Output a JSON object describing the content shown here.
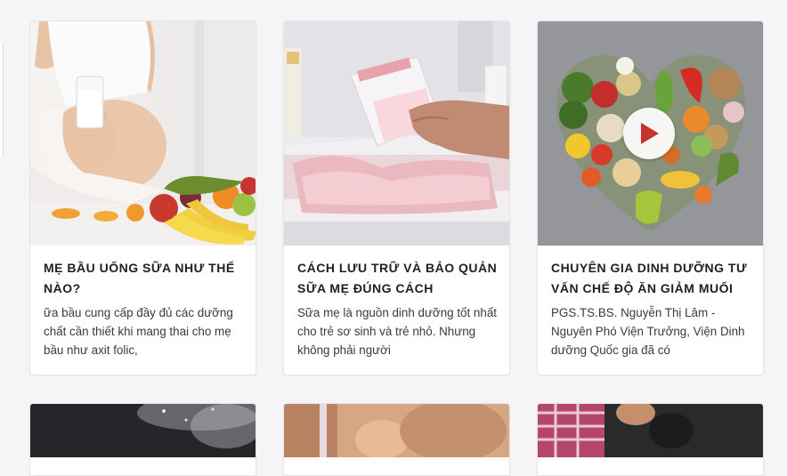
{
  "articles": [
    {
      "title": "MẸ BẦU UỐNG SỮA NHƯ THẾ NÀO?",
      "excerpt": "ữa bầu cung cấp đầy đủ các dưỡng chất cần thiết khi mang thai cho mẹ bầu như axit folic,",
      "thumbnail_icon": "pregnant-woman-drinking-milk-image"
    },
    {
      "title": "CÁCH LƯU TRỮ VÀ BẢO QUẢN SỮA MẸ ĐÚNG CÁCH",
      "excerpt": "Sữa mẹ là nguồn dinh dưỡng tốt nhất cho trẻ sơ sinh và trẻ nhỏ. Nhưng không phải người",
      "thumbnail_icon": "breast-milk-storage-bags-image"
    },
    {
      "title": "CHUYÊN GIA DINH DƯỠNG TƯ VẤN CHẾ ĐỘ ĂN GIẢM MUỐI",
      "excerpt": "PGS.TS.BS. Nguyễn Thị Lâm - Nguyên Phó Viện Trưởng, Viện Dinh dưỡng Quốc gia đã có",
      "thumbnail_icon": "vegetable-heart-image",
      "has_video": true
    }
  ],
  "colors": {
    "page_background": "#f5f5f7",
    "card_background": "#ffffff",
    "title_color": "#1f1f25",
    "text_color": "#3a3a3f",
    "play_icon_color": "#c8322f"
  }
}
